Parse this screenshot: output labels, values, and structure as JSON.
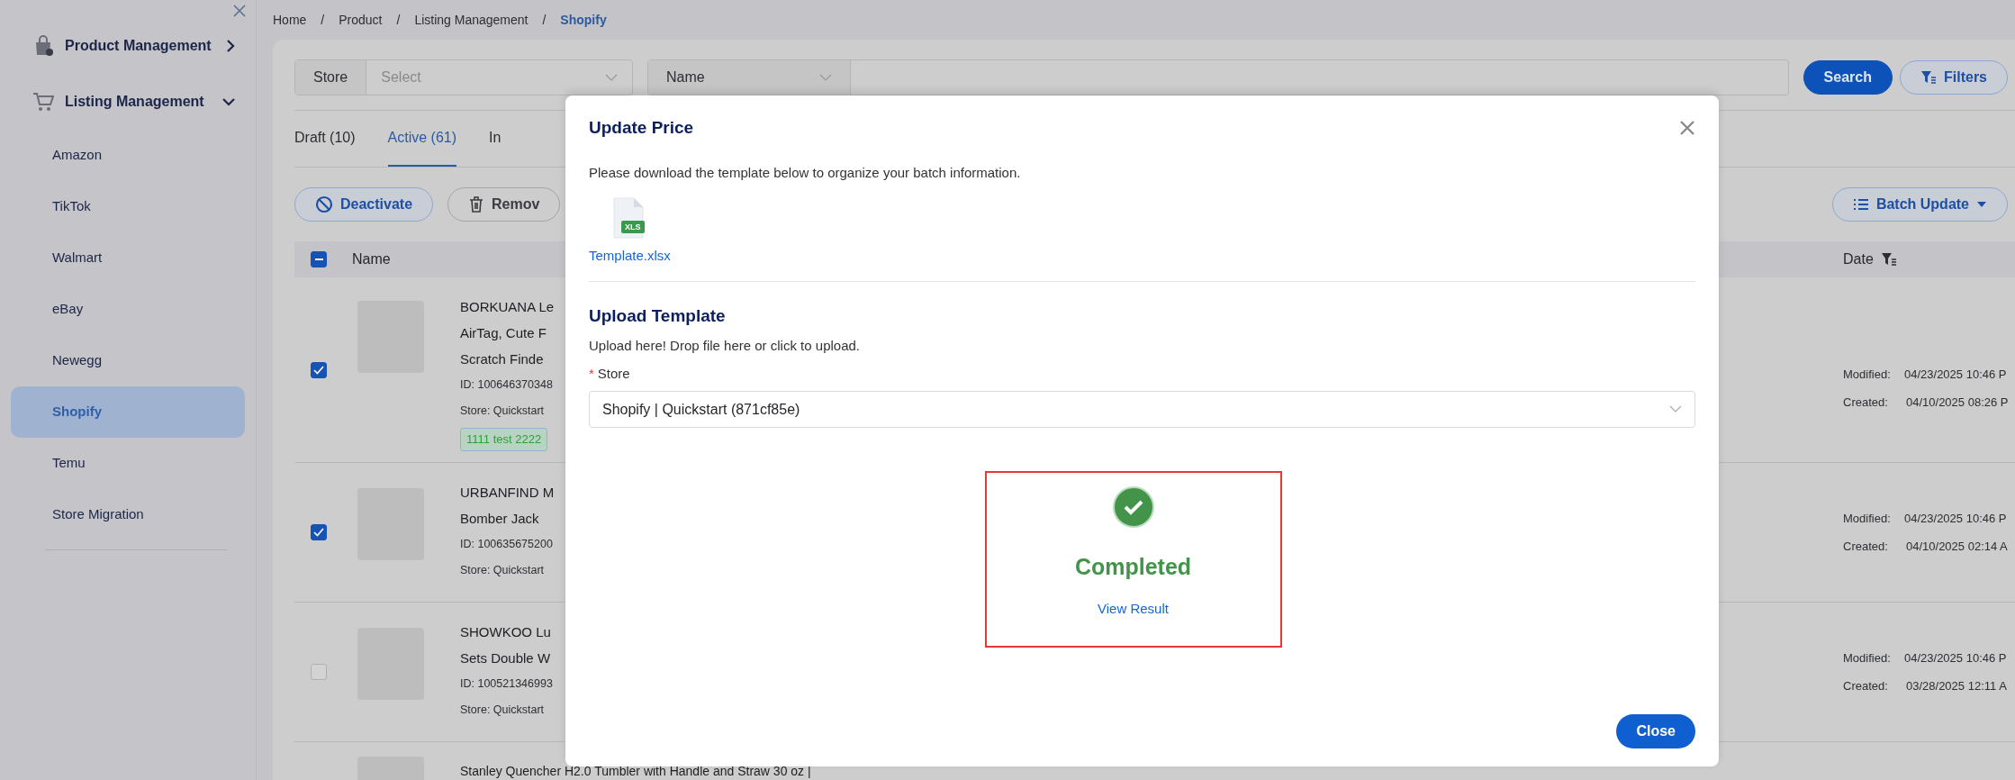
{
  "sidebar": {
    "groups": [
      {
        "label": "Product Management",
        "kind": "product",
        "expanded": false
      },
      {
        "label": "Listing Management",
        "kind": "listing",
        "expanded": true,
        "children": [
          {
            "label": "Amazon",
            "selected": false
          },
          {
            "label": "TikTok",
            "selected": false
          },
          {
            "label": "Walmart",
            "selected": false
          },
          {
            "label": "eBay",
            "selected": false
          },
          {
            "label": "Newegg",
            "selected": false
          },
          {
            "label": "Shopify",
            "selected": true
          },
          {
            "label": "Temu",
            "selected": false
          },
          {
            "label": "Store Migration",
            "selected": false
          }
        ]
      }
    ]
  },
  "breadcrumb": [
    {
      "label": "Home",
      "kind": "link",
      "current": false
    },
    {
      "label": "/",
      "kind": "separator"
    },
    {
      "label": "Product",
      "kind": "link",
      "current": false
    },
    {
      "label": "/",
      "kind": "separator"
    },
    {
      "label": "Listing Management",
      "kind": "link",
      "current": false
    },
    {
      "label": "/",
      "kind": "separator"
    },
    {
      "label": "Shopify",
      "kind": "link",
      "current": true
    }
  ],
  "filters": {
    "store_label": "Store",
    "store_placeholder": "Select",
    "field_select": "Name",
    "search_button": "Search",
    "filters_button": "Filters"
  },
  "tabs": [
    {
      "label": "Draft (10)",
      "selected": false
    },
    {
      "label": "Active (61)",
      "selected": true
    },
    {
      "label": "In",
      "selected": false
    }
  ],
  "actions": [
    {
      "label": "Deactivate",
      "kind": "deactivate"
    },
    {
      "label": "Remov",
      "kind": "remove"
    }
  ],
  "batch_button": "Batch Update",
  "table": {
    "select_all_indeterminate": true,
    "columns": [
      "Name",
      "Date"
    ],
    "rows": [
      {
        "checked": true,
        "lines": [
          "BORKUANA Le",
          "AirTag, Cute F",
          "Scratch Finde"
        ],
        "id": "ID: 100646370348",
        "store": "Store: Quickstart",
        "tags": [
          {
            "label": "1111 test 2222",
            "color": "#2e9e3e"
          }
        ],
        "modified_label": "Modified:",
        "modified": "04/23/2025 10:46 P",
        "created_label": "Created:",
        "created": "04/10/2025 08:26 P"
      },
      {
        "checked": true,
        "lines": [
          "URBANFIND M",
          "Bomber Jack"
        ],
        "id": "ID: 100635675200",
        "store": "Store: Quickstart",
        "modified_label": "Modified:",
        "modified": "04/23/2025 10:46 P",
        "created_label": "Created:",
        "created": "04/10/2025 02:14 A"
      },
      {
        "checked": false,
        "lines": [
          "SHOWKOO Lu",
          "Sets Double W"
        ],
        "id": "ID: 100521346993",
        "store": "Store: Quickstart",
        "modified_label": "Modified:",
        "modified": "04/23/2025 10:46 P",
        "created_label": "Created:",
        "created": "03/28/2025 12:11 A"
      },
      {
        "lines": [
          "Stanley Quencher H2.0 Tumbler with Handle and Straw 30 oz |"
        ]
      }
    ]
  },
  "modal": {
    "title": "Update Price",
    "intro": "Please download the template below to organize your batch information.",
    "file_badge": "XLS",
    "file_name": "Template.xlsx",
    "upload_title": "Upload Template",
    "upload_hint": "Upload here! Drop file here or click to upload.",
    "store_required_mark": "*",
    "store_label": "Store",
    "store_value": "Shopify | Quickstart (871cf85e)",
    "succeeded": true,
    "status_text": "Completed",
    "result_link": "View Result",
    "close_button": "Close"
  }
}
